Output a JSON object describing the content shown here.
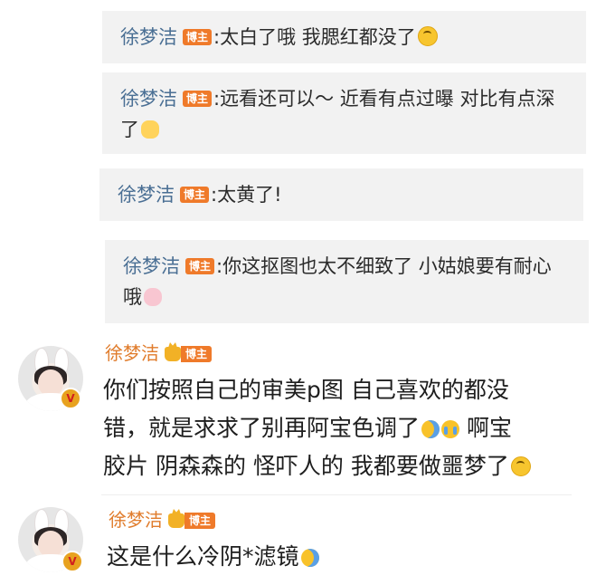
{
  "replies": [
    {
      "name": "徐梦洁",
      "badge": "博主",
      "sep": ":",
      "text": "太白了哦 我腮红都没了",
      "emoji": "upside-down-face-icon"
    },
    {
      "name": "徐梦洁",
      "badge": "博主",
      "sep": ":",
      "text": "远看还可以～ 近看有点过曝 对比有点深了",
      "emoji": "flower-face-icon"
    },
    {
      "name": "徐梦洁",
      "badge": "博主",
      "sep": ":",
      "text": "太黄了!",
      "emoji": ""
    },
    {
      "name": "徐梦洁",
      "badge": "博主",
      "sep": ":",
      "text": "你这抠图也太不细致了 小姑娘要有耐心哦",
      "emoji": "pig-face-icon"
    }
  ],
  "comments": [
    {
      "name": "徐梦洁",
      "badge": "博主",
      "text_lines": [
        "你们按照自己的审美p图 自己喜欢的都没",
        "错，就是求求了别再阿宝色调了",
        "胶片 阴森森的 怪吓人的 我都要做噩梦了"
      ],
      "line2_tail": "啊宝",
      "verified": "V"
    },
    {
      "name": "徐梦洁",
      "badge": "博主",
      "text_lines": [
        "这是什么冷阴*滤镜"
      ],
      "verified": "V"
    }
  ]
}
